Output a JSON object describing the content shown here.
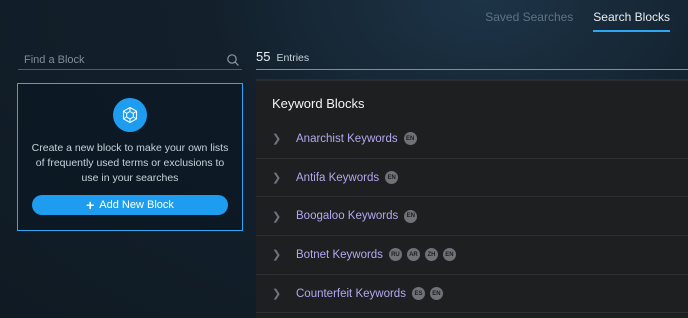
{
  "nav": {
    "tabs": [
      {
        "label": "Saved Searches"
      },
      {
        "label": "Search Blocks"
      }
    ]
  },
  "search": {
    "placeholder": "Find a Block",
    "icon": "search-icon"
  },
  "create_card": {
    "icon": "block-icon",
    "text": "Create a new block to make your own lists of frequently used terms or exclusions to use in your searches",
    "button_label": "Add New Block"
  },
  "entries": {
    "count": "55",
    "label": "Entries"
  },
  "panel": {
    "title": "Keyword Blocks",
    "rows": [
      {
        "name": "Anarchist Keywords",
        "badges": [
          "EN"
        ]
      },
      {
        "name": "Antifa Keywords",
        "badges": [
          "EN"
        ]
      },
      {
        "name": "Boogaloo Keywords",
        "badges": [
          "EN"
        ]
      },
      {
        "name": "Botnet Keywords",
        "badges": [
          "RU",
          "AR",
          "ZH",
          "EN"
        ]
      },
      {
        "name": "Counterfeit Keywords",
        "badges": [
          "ES",
          "EN"
        ]
      }
    ]
  },
  "colors": {
    "accent": "#2ea6f2",
    "link": "#b6a7ef",
    "panel_bg": "#1d1f21"
  }
}
